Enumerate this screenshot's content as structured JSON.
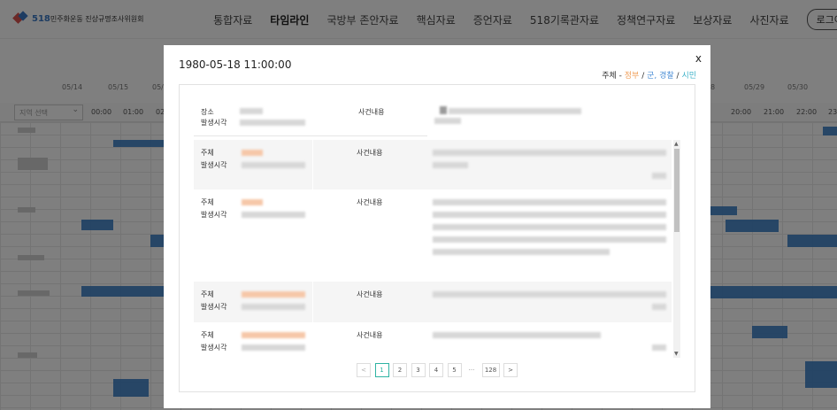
{
  "header": {
    "logo_text": "민주화운동 진상규명조사위원회",
    "logo_number": "518",
    "nav": [
      "통합자료",
      "타임라인",
      "국방부 존안자료",
      "핵심자료",
      "증언자료",
      "518기록관자료",
      "정책연구자료",
      "보상자료",
      "사진자료"
    ],
    "active_nav": "타임라인",
    "login_label": "로그아"
  },
  "timeline": {
    "dates": [
      "05/14",
      "05/15",
      "05/1",
      "8",
      "05/29",
      "05/30"
    ],
    "hours": [
      "00:00",
      "01:00",
      "02",
      "20:00",
      "21:00",
      "22:00",
      "23"
    ],
    "region_placeholder": "지역 선택"
  },
  "modal": {
    "title": "1980-05-18 11:00:00",
    "close_label": "x",
    "legend": {
      "prefix": "주체 - ",
      "gov": "정부",
      "sep1": " / ",
      "army": "군, 경찰",
      "sep2": " / ",
      "civ": "시민"
    },
    "place_block": {
      "place_label": "장소",
      "time_label": "발생시각",
      "content_label": "사건내용"
    },
    "events": [
      {
        "subject_label": "주체",
        "time_label": "발생시각",
        "content_label": "사건내용"
      },
      {
        "subject_label": "주체",
        "time_label": "발생시각",
        "content_label": "사건내용"
      },
      {
        "subject_label": "주체",
        "time_label": "발생시각",
        "content_label": "사건내용"
      },
      {
        "subject_label": "주체",
        "time_label": "발생시각",
        "content_label": "사건내용"
      }
    ],
    "pagination": {
      "prev": "<",
      "pages": [
        "1",
        "2",
        "3",
        "4",
        "5"
      ],
      "ellipsis": "···",
      "last": "128",
      "next": ">",
      "current": "1"
    }
  },
  "colors": {
    "gov": "#f0a05b",
    "army": "#4d8fd6",
    "civ": "#3fb2c9",
    "active_page": "#2eb3a3",
    "timeline_bar": "#3c7fc6"
  }
}
